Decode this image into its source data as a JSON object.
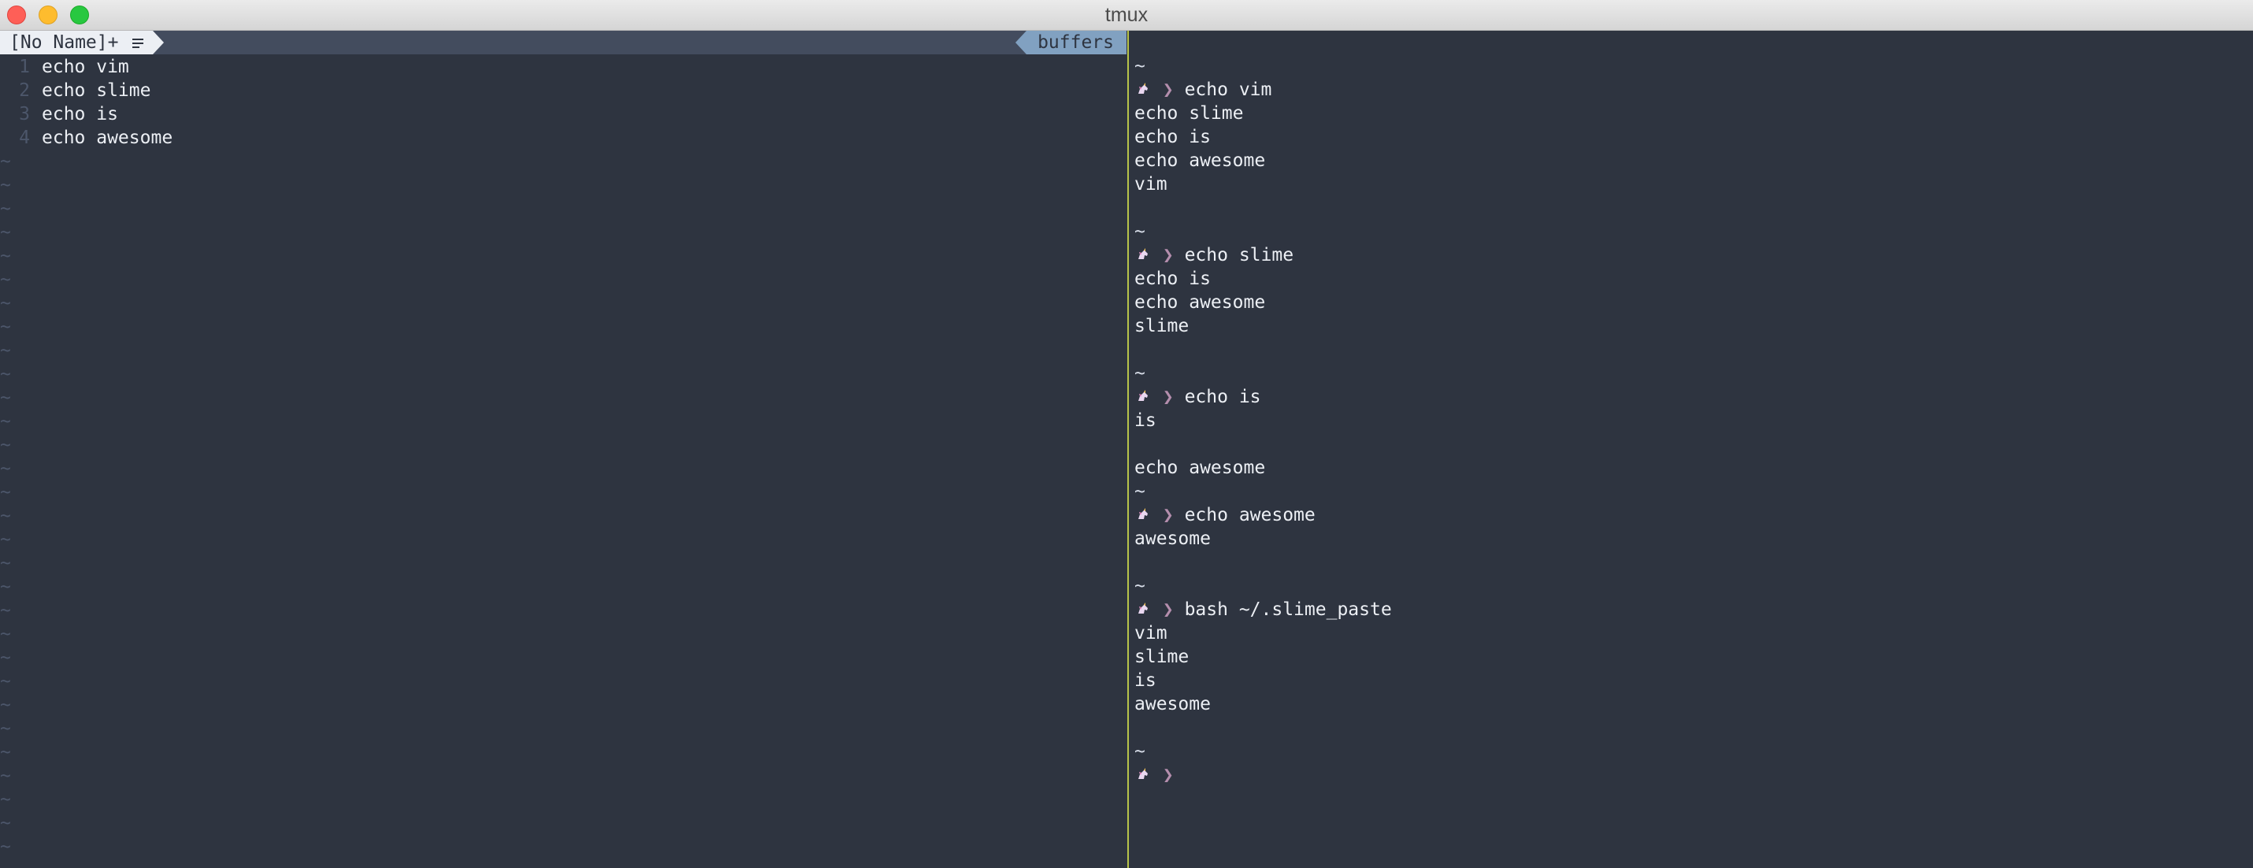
{
  "window": {
    "title": "tmux"
  },
  "vim": {
    "tab_label": "[No Name]+",
    "tab_icon": "list-icon",
    "right_label": "buffers",
    "lines": [
      {
        "num": "1",
        "text": "echo vim"
      },
      {
        "num": "2",
        "text": "echo slime"
      },
      {
        "num": "3",
        "text": "echo is"
      },
      {
        "num": "4",
        "text": "echo awesome"
      }
    ],
    "tilde": "~"
  },
  "terminal": {
    "prompt_icon": "unicorn-icon",
    "prompt_symbol": "❯",
    "lines": [
      {
        "kind": "text",
        "text": "~"
      },
      {
        "kind": "prompt",
        "text": "echo vim"
      },
      {
        "kind": "text",
        "text": "echo slime"
      },
      {
        "kind": "text",
        "text": "echo is"
      },
      {
        "kind": "text",
        "text": "echo awesome"
      },
      {
        "kind": "text",
        "text": "vim"
      },
      {
        "kind": "text",
        "text": ""
      },
      {
        "kind": "text",
        "text": "~"
      },
      {
        "kind": "prompt",
        "text": "echo slime"
      },
      {
        "kind": "text",
        "text": "echo is"
      },
      {
        "kind": "text",
        "text": "echo awesome"
      },
      {
        "kind": "text",
        "text": "slime"
      },
      {
        "kind": "text",
        "text": ""
      },
      {
        "kind": "text",
        "text": "~"
      },
      {
        "kind": "prompt",
        "text": "echo is"
      },
      {
        "kind": "text",
        "text": "is"
      },
      {
        "kind": "text",
        "text": ""
      },
      {
        "kind": "text",
        "text": "echo awesome"
      },
      {
        "kind": "text",
        "text": "~"
      },
      {
        "kind": "prompt",
        "text": "echo awesome"
      },
      {
        "kind": "text",
        "text": "awesome"
      },
      {
        "kind": "text",
        "text": ""
      },
      {
        "kind": "text",
        "text": "~"
      },
      {
        "kind": "prompt",
        "text": "bash ~/.slime_paste"
      },
      {
        "kind": "text",
        "text": "vim"
      },
      {
        "kind": "text",
        "text": "slime"
      },
      {
        "kind": "text",
        "text": "is"
      },
      {
        "kind": "text",
        "text": "awesome"
      },
      {
        "kind": "text",
        "text": ""
      },
      {
        "kind": "text",
        "text": "~"
      },
      {
        "kind": "prompt",
        "text": ""
      }
    ]
  },
  "colors": {
    "background": "#2e3440",
    "pane_divider": "#b7c34a",
    "prompt_symbol": "#b48ead",
    "tab_active_bg": "#eceff4",
    "tab_buffers_bg": "#81a1c1"
  }
}
